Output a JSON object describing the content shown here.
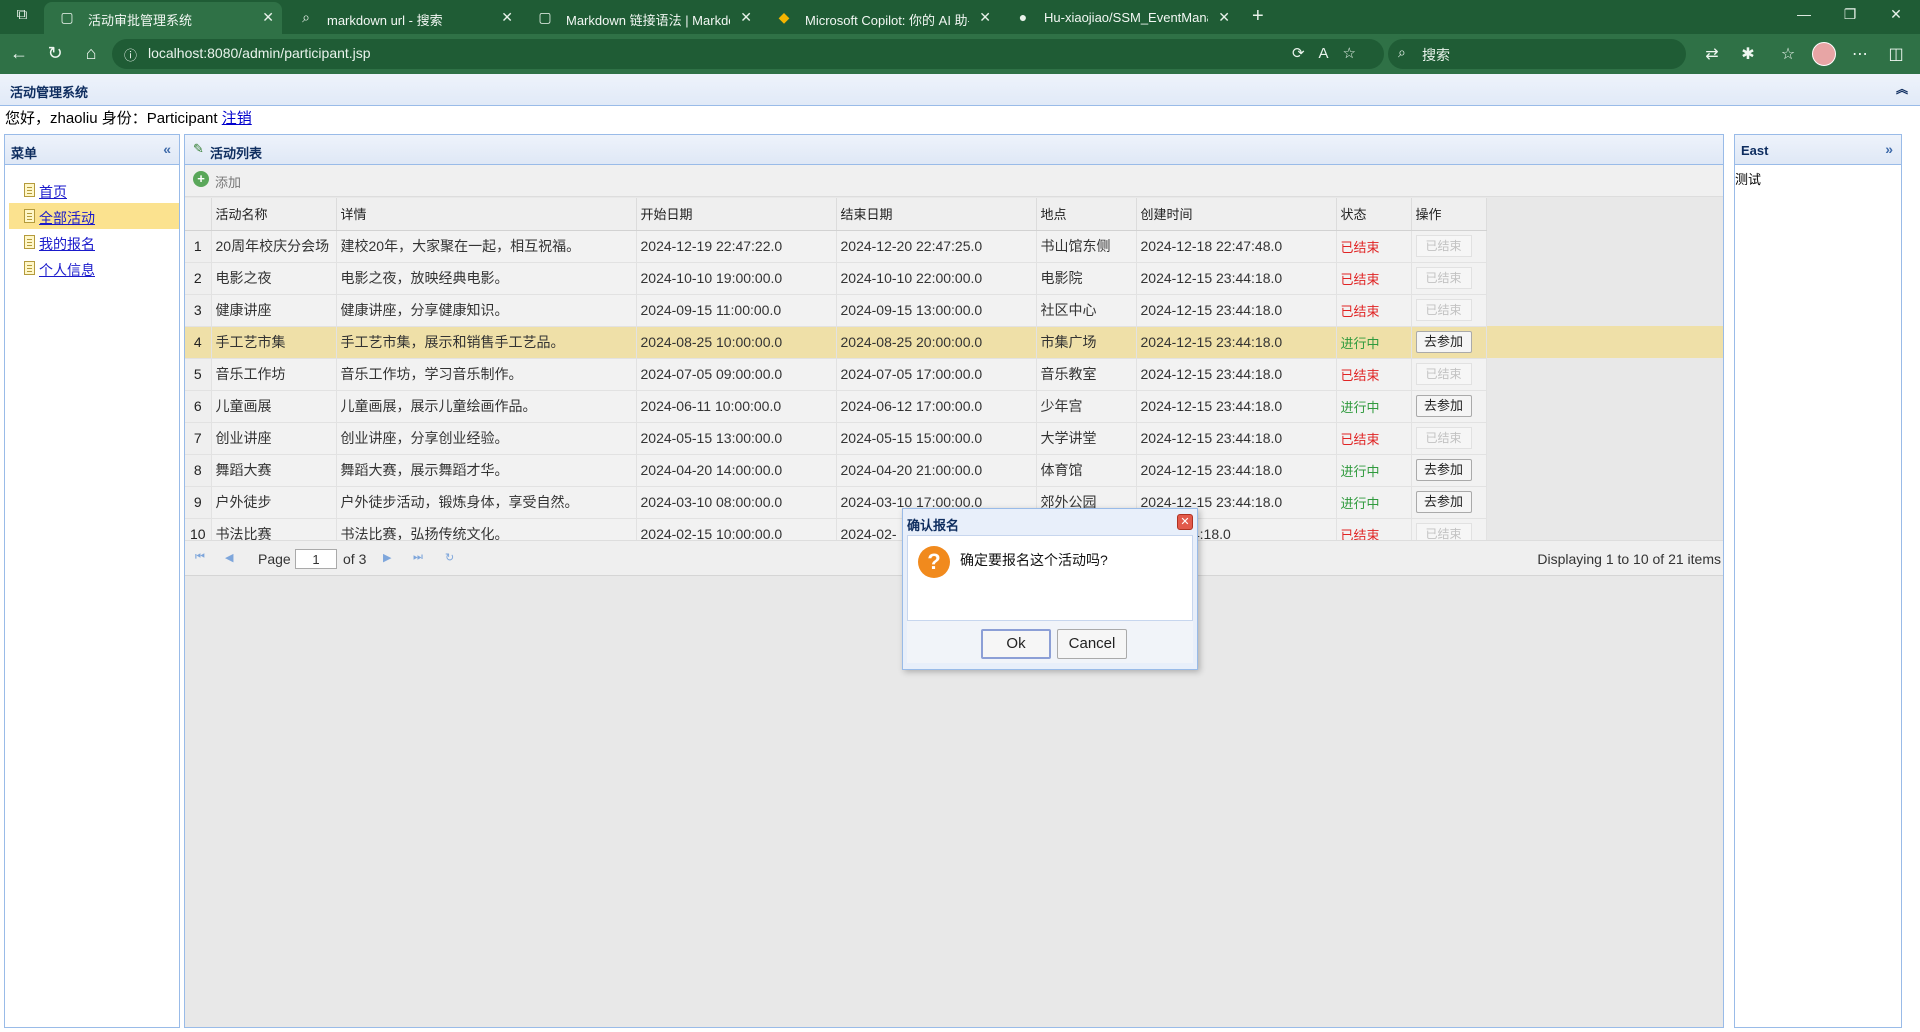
{
  "browser": {
    "tabs": [
      {
        "title": "活动审批管理系统",
        "icon": "page-icon"
      },
      {
        "title": "markdown url - 搜索",
        "icon": "search-icon"
      },
      {
        "title": "Markdown 链接语法 | Markdown",
        "icon": "page-icon"
      },
      {
        "title": "Microsoft Copilot: 你的 AI 助手",
        "icon": "copilot-icon"
      },
      {
        "title": "Hu-xiaojiao/SSM_EventManagem",
        "icon": "github-icon"
      }
    ],
    "url": "localhost:8080/admin/participant.jsp",
    "search_placeholder": "搜索"
  },
  "header": {
    "title": "活动管理系统",
    "greeting": "您好，zhaoliu 身份：Participant",
    "logout_label": "注销"
  },
  "west": {
    "title": "菜单",
    "items": [
      {
        "label": "首页"
      },
      {
        "label": "全部活动"
      },
      {
        "label": "我的报名"
      },
      {
        "label": "个人信息"
      }
    ]
  },
  "center": {
    "title": "活动列表",
    "add_label": "添加",
    "columns": [
      "活动名称",
      "详情",
      "开始日期",
      "结束日期",
      "地点",
      "创建时间",
      "状态",
      "操作"
    ],
    "rows": [
      {
        "num": "1",
        "name": "20周年校庆分会场",
        "detail": "建校20年，大家聚在一起，相互祝福。",
        "start": "2024-12-19 22:47:22.0",
        "end": "2024-12-20 22:47:25.0",
        "place": "书山馆东侧",
        "created": "2024-12-18 22:47:48.0",
        "status": "已结束",
        "action": "已结束"
      },
      {
        "num": "2",
        "name": "电影之夜",
        "detail": "电影之夜，放映经典电影。",
        "start": "2024-10-10 19:00:00.0",
        "end": "2024-10-10 22:00:00.0",
        "place": "电影院",
        "created": "2024-12-15 23:44:18.0",
        "status": "已结束",
        "action": "已结束"
      },
      {
        "num": "3",
        "name": "健康讲座",
        "detail": "健康讲座，分享健康知识。",
        "start": "2024-09-15 11:00:00.0",
        "end": "2024-09-15 13:00:00.0",
        "place": "社区中心",
        "created": "2024-12-15 23:44:18.0",
        "status": "已结束",
        "action": "已结束"
      },
      {
        "num": "4",
        "name": "手工艺市集",
        "detail": "手工艺市集，展示和销售手工艺品。",
        "start": "2024-08-25 10:00:00.0",
        "end": "2024-08-25 20:00:00.0",
        "place": "市集广场",
        "created": "2024-12-15 23:44:18.0",
        "status": "进行中",
        "action": "去参加"
      },
      {
        "num": "5",
        "name": "音乐工作坊",
        "detail": "音乐工作坊，学习音乐制作。",
        "start": "2024-07-05 09:00:00.0",
        "end": "2024-07-05 17:00:00.0",
        "place": "音乐教室",
        "created": "2024-12-15 23:44:18.0",
        "status": "已结束",
        "action": "已结束"
      },
      {
        "num": "6",
        "name": "儿童画展",
        "detail": "儿童画展，展示儿童绘画作品。",
        "start": "2024-06-11 10:00:00.0",
        "end": "2024-06-12 17:00:00.0",
        "place": "少年宫",
        "created": "2024-12-15 23:44:18.0",
        "status": "进行中",
        "action": "去参加"
      },
      {
        "num": "7",
        "name": "创业讲座",
        "detail": "创业讲座，分享创业经验。",
        "start": "2024-05-15 13:00:00.0",
        "end": "2024-05-15 15:00:00.0",
        "place": "大学讲堂",
        "created": "2024-12-15 23:44:18.0",
        "status": "已结束",
        "action": "已结束"
      },
      {
        "num": "8",
        "name": "舞蹈大赛",
        "detail": "舞蹈大赛，展示舞蹈才华。",
        "start": "2024-04-20 14:00:00.0",
        "end": "2024-04-20 21:00:00.0",
        "place": "体育馆",
        "created": "2024-12-15 23:44:18.0",
        "status": "进行中",
        "action": "去参加"
      },
      {
        "num": "9",
        "name": "户外徒步",
        "detail": "户外徒步活动，锻炼身体，享受自然。",
        "start": "2024-03-10 08:00:00.0",
        "end": "2024-03-10 17:00:00.0",
        "place": "郊外公园",
        "created": "2024-12-15 23:44:18.0",
        "status": "进行中",
        "action": "去参加"
      },
      {
        "num": "10",
        "name": "书法比赛",
        "detail": "书法比赛，弘扬传统文化。",
        "start": "2024-02-15 10:00:00.0",
        "end": "2024-02-",
        "place": "",
        "created": "-15 23:44:18.0",
        "status": "已结束",
        "action": "已结束"
      }
    ],
    "highlighted_row": 4,
    "pager": {
      "page_label": "Page",
      "page_value": "1",
      "of_label": "of 3",
      "status": "Displaying 1 to 10 of 21 items"
    }
  },
  "east": {
    "title": "East",
    "body": "测试"
  },
  "dialog": {
    "title": "确认报名",
    "message": "确定要报名这个活动吗?",
    "ok_label": "Ok",
    "cancel_label": "Cancel"
  },
  "colors": {
    "ended": "#e02424",
    "ongoing": "#2f9a3d",
    "highlight_row": "#efe0a8",
    "selected_menu": "#fbe28f",
    "browser_frame": "#1f5c35"
  }
}
